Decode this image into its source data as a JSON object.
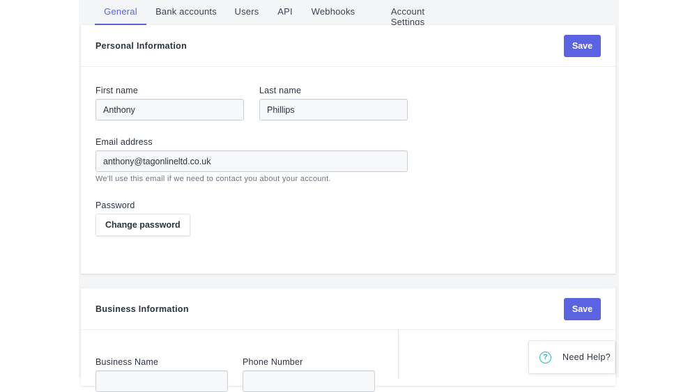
{
  "tabs": [
    {
      "label": "General",
      "active": true
    },
    {
      "label": "Bank accounts",
      "active": false
    },
    {
      "label": "Users",
      "active": false
    },
    {
      "label": "API",
      "active": false
    },
    {
      "label": "Webhooks",
      "active": false
    },
    {
      "label": "Account Settings",
      "active": false
    }
  ],
  "personal": {
    "title": "Personal Information",
    "save_label": "Save",
    "first_name": {
      "label": "First name",
      "value": "Anthony"
    },
    "last_name": {
      "label": "Last name",
      "value": "Phillips"
    },
    "email": {
      "label": "Email address",
      "value": "anthony@tagonlineltd.co.uk",
      "help": "We'll use this email if we need to contact you about your account."
    },
    "password": {
      "label": "Password",
      "button_label": "Change password"
    }
  },
  "business": {
    "title": "Business Information",
    "save_label": "Save",
    "business_name": {
      "label": "Business Name",
      "value": ""
    },
    "phone_number": {
      "label": "Phone Number",
      "value": ""
    }
  },
  "help_widget": {
    "icon": "question-circle-icon",
    "label": "Need Help?"
  },
  "colors": {
    "accent": "#5b63e0",
    "help_icon": "#2bb5b0",
    "page_bg": "#f4f5f7"
  }
}
